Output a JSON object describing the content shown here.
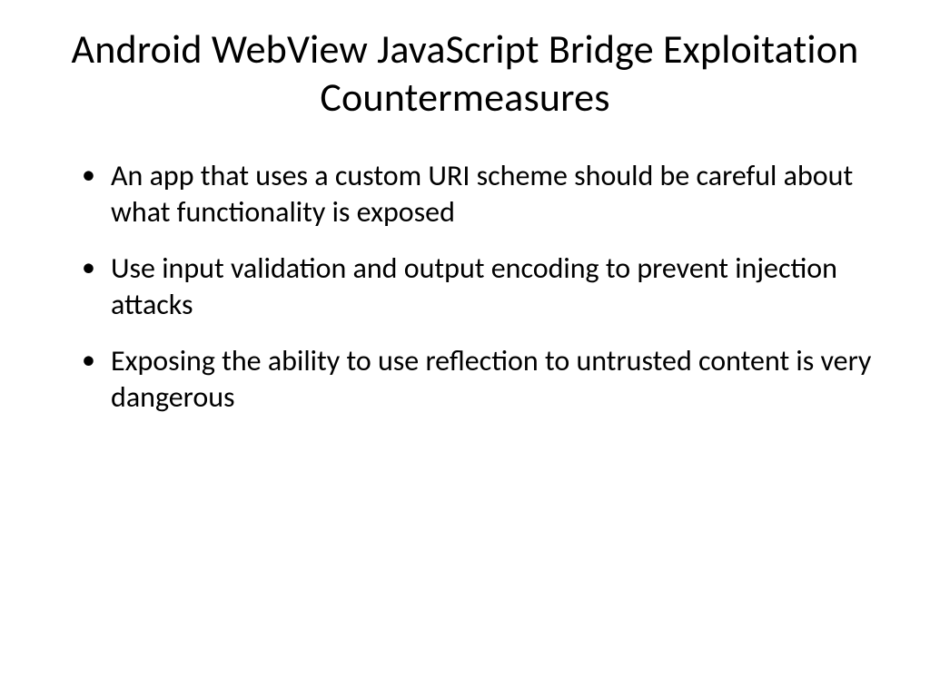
{
  "slide": {
    "title": "Android WebView JavaScript Bridge Exploitation Countermeasures",
    "bullets": [
      "An app that uses a custom URI scheme should be careful about what functionality is exposed",
      "Use input validation and output encoding to prevent injection attacks",
      "Exposing the ability to use reflection to untrusted content is very dangerous"
    ]
  }
}
